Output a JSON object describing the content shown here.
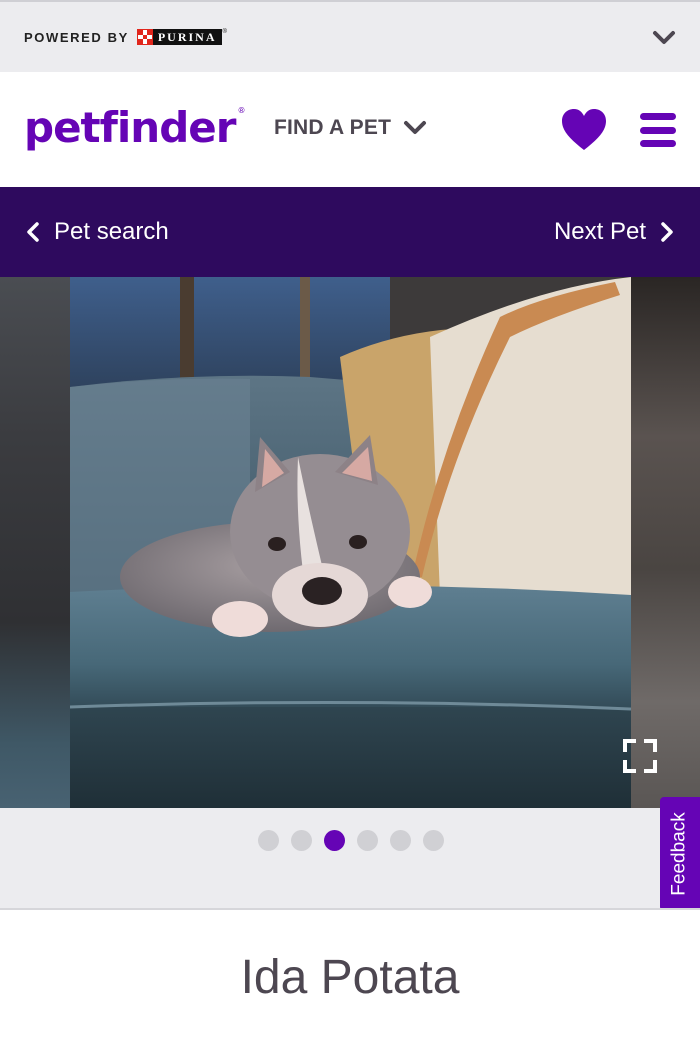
{
  "powered_bar": {
    "powered_by_label": "POWERED BY",
    "partner_name": "PURINA",
    "partner_reg_mark": "®",
    "toggle_icon": "chevron-down-icon"
  },
  "header": {
    "brand_name": "petfinder",
    "brand_reg_mark": "®",
    "find_pet_label": "FIND A PET",
    "find_pet_icon": "chevron-down-icon",
    "favorites_icon": "heart-icon",
    "menu_icon": "hamburger-menu-icon"
  },
  "pet_nav": {
    "back_label": "Pet search",
    "back_icon": "chevron-left-icon",
    "next_label": "Next Pet",
    "next_icon": "chevron-right-icon"
  },
  "carousel": {
    "photo_subject": "gray dog lying on a blue couch",
    "expand_icon": "fullscreen-icon",
    "photo_count": 6,
    "active_index": 3
  },
  "feedback": {
    "label": "Feedback"
  },
  "pet": {
    "name": "Ida Potata"
  },
  "colors": {
    "brand_purple": "#6504b5",
    "nav_bar_bg": "#2e0a5e",
    "top_bar_bg": "#ececef",
    "text_gray": "#4d4751"
  }
}
